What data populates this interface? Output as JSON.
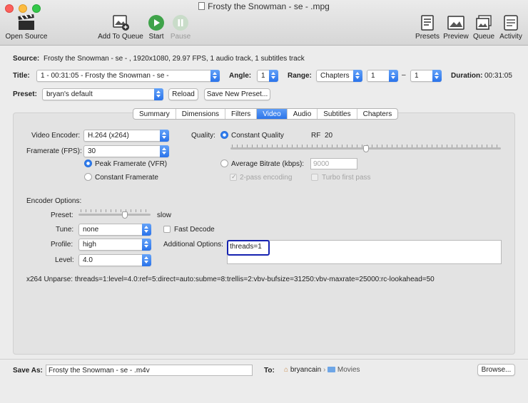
{
  "window": {
    "title": "Frosty the Snowman - se - .mpg"
  },
  "toolbar": {
    "open_source": "Open Source",
    "add_to_queue": "Add To Queue",
    "start": "Start",
    "pause": "Pause",
    "presets": "Presets",
    "preview": "Preview",
    "queue": "Queue",
    "activity": "Activity"
  },
  "source": {
    "label": "Source:",
    "value": "Frosty the Snowman - se - , 1920x1080, 29.97 FPS, 1 audio track, 1 subtitles track"
  },
  "title_row": {
    "label": "Title:",
    "value": "1 - 00:31:05 - Frosty the Snowman - se -",
    "angle_label": "Angle:",
    "angle_value": "1",
    "range_label": "Range:",
    "range_type": "Chapters",
    "range_from": "1",
    "range_dash": "–",
    "range_to": "1",
    "duration_label": "Duration:",
    "duration_value": "00:31:05"
  },
  "preset_row": {
    "label": "Preset:",
    "value": "bryan's default",
    "reload": "Reload",
    "save_new": "Save New Preset..."
  },
  "tabs": [
    "Summary",
    "Dimensions",
    "Filters",
    "Video",
    "Audio",
    "Subtitles",
    "Chapters"
  ],
  "active_tab": "Video",
  "video": {
    "encoder_label": "Video Encoder:",
    "encoder_value": "H.264 (x264)",
    "framerate_label": "Framerate (FPS):",
    "framerate_value": "30",
    "peak_framerate": "Peak Framerate (VFR)",
    "constant_framerate": "Constant Framerate",
    "quality_label": "Quality:",
    "constant_quality": "Constant Quality",
    "rf_label": "RF",
    "rf_value": "20",
    "rf_position": 0.5,
    "average_bitrate": "Average Bitrate (kbps):",
    "bitrate_placeholder": "9000",
    "two_pass": "2-pass encoding",
    "turbo": "Turbo first pass"
  },
  "encoder_options": {
    "heading": "Encoder Options:",
    "preset_label": "Preset:",
    "preset_slow": "slow",
    "preset_position": 0.64,
    "tune_label": "Tune:",
    "tune_value": "none",
    "fast_decode": "Fast Decode",
    "profile_label": "Profile:",
    "profile_value": "high",
    "additional_label": "Additional Options:",
    "additional_value": "threads=1",
    "level_label": "Level:",
    "level_value": "4.0",
    "unparse": "x264 Unparse: threads=1:level=4.0:ref=5:direct=auto:subme=8:trellis=2:vbv-bufsize=31250:vbv-maxrate=25000:rc-lookahead=50"
  },
  "save": {
    "label": "Save As:",
    "value": "Frosty the Snowman - se - .m4v",
    "to_label": "To:",
    "path_user": "bryancain",
    "path_sep": "›",
    "path_folder": "Movies",
    "browse": "Browse..."
  },
  "colors": {
    "accent": "#2c75ea",
    "highlight_box": "#1522b0"
  }
}
